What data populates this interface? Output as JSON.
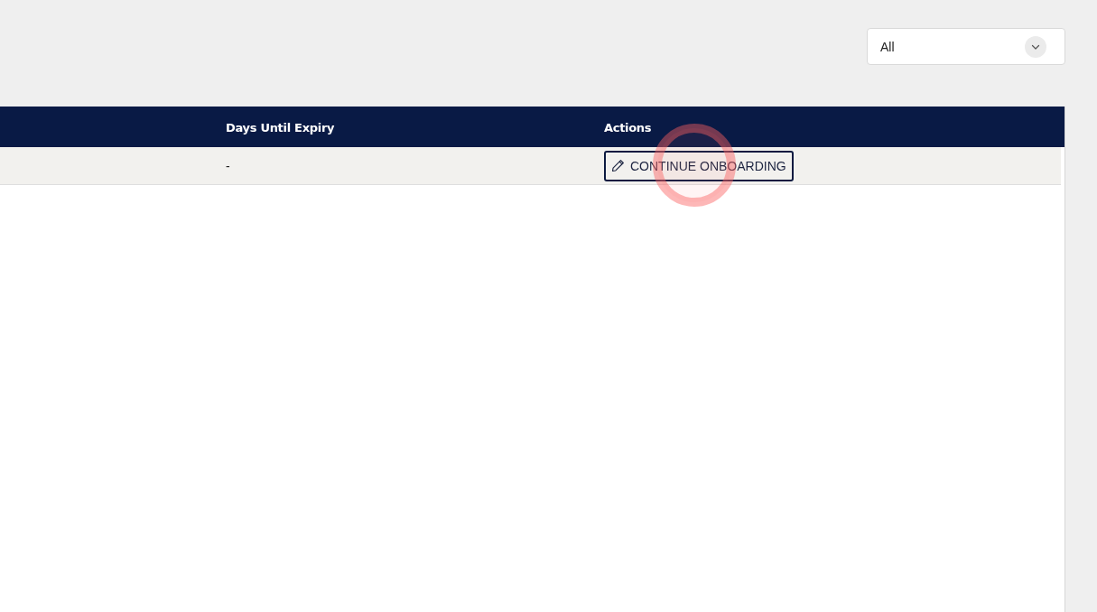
{
  "filter": {
    "value": "All"
  },
  "table": {
    "columns": [
      {
        "label": "Days Until Expiry"
      },
      {
        "label": "Actions"
      }
    ],
    "rows": [
      {
        "days_until_expiry": "-",
        "action": {
          "label": "CONTINUE ONBOARDING"
        }
      }
    ]
  }
}
